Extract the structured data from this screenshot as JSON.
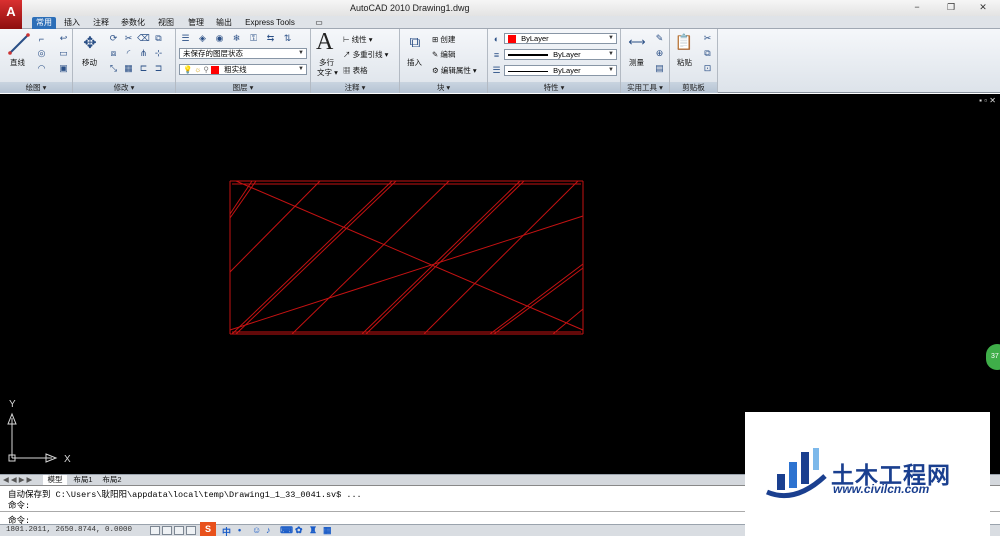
{
  "window": {
    "app_logo": "A",
    "title": "AutoCAD 2010      Drawing1.dwg",
    "minimize": "−",
    "restore": "❐",
    "close": "✕"
  },
  "tabs": [
    "常用",
    "插入",
    "注释",
    "参数化",
    "视图",
    "管理",
    "输出",
    "Express Tools"
  ],
  "tabs_extra": "▭",
  "ribbon": {
    "draw": {
      "line_label": "直线",
      "footer": "绘图 ▾"
    },
    "modify": {
      "move_label": "移动",
      "footer": "修改 ▾"
    },
    "layers": {
      "layer_state": "未保存的图层状态",
      "current_layer": "粗实线",
      "footer": "图层 ▾",
      "layer_color": "#ff0000"
    },
    "annotation": {
      "text_label_1": "多行",
      "text_label_2": "文字 ▾",
      "linear": "线性 ▾",
      "multileader": "多重引线 ▾",
      "table": "表格",
      "footer": "注释 ▾"
    },
    "block": {
      "insert_label": "插入",
      "create": "创建",
      "edit": "编辑",
      "edit_attr": "编辑属性 ▾",
      "footer": "块 ▾"
    },
    "properties": {
      "color": "ByLayer",
      "lineweight": "ByLayer",
      "linetype": "ByLayer",
      "footer": "特性 ▾",
      "color_swatch": "#ff0000"
    },
    "utilities": {
      "measure_label": "测量",
      "footer": "实用工具 ▾"
    },
    "clipboard": {
      "paste_label": "粘贴",
      "footer": "剪贴板"
    }
  },
  "viewport": {
    "controls": "▪ ▫ ✕"
  },
  "ucs": {
    "y": "Y",
    "x": "X"
  },
  "float_badge": "37",
  "layout_tabs": {
    "nav": "◀ ◀ ▶ ▶",
    "model": "模型",
    "layout1": "布局1",
    "layout2": "布局2"
  },
  "command": {
    "line1": "自动保存到 C:\\Users\\耿阳阳\\appdata\\local\\temp\\Drawing1_1_33_0041.sv$ ...",
    "line2": "命令:",
    "prompt": "命令:"
  },
  "status": {
    "coords": "1801.2011, 2650.8744, 0.0000",
    "ime_s": "S",
    "ime_zh": "中"
  },
  "watermark": {
    "cn": "土木工程网",
    "url": "www.civilcn.com"
  },
  "colors": {
    "drawing_line": "#c41212",
    "ribbon_accent": "#2d6fb8",
    "canvas": "#000000"
  }
}
